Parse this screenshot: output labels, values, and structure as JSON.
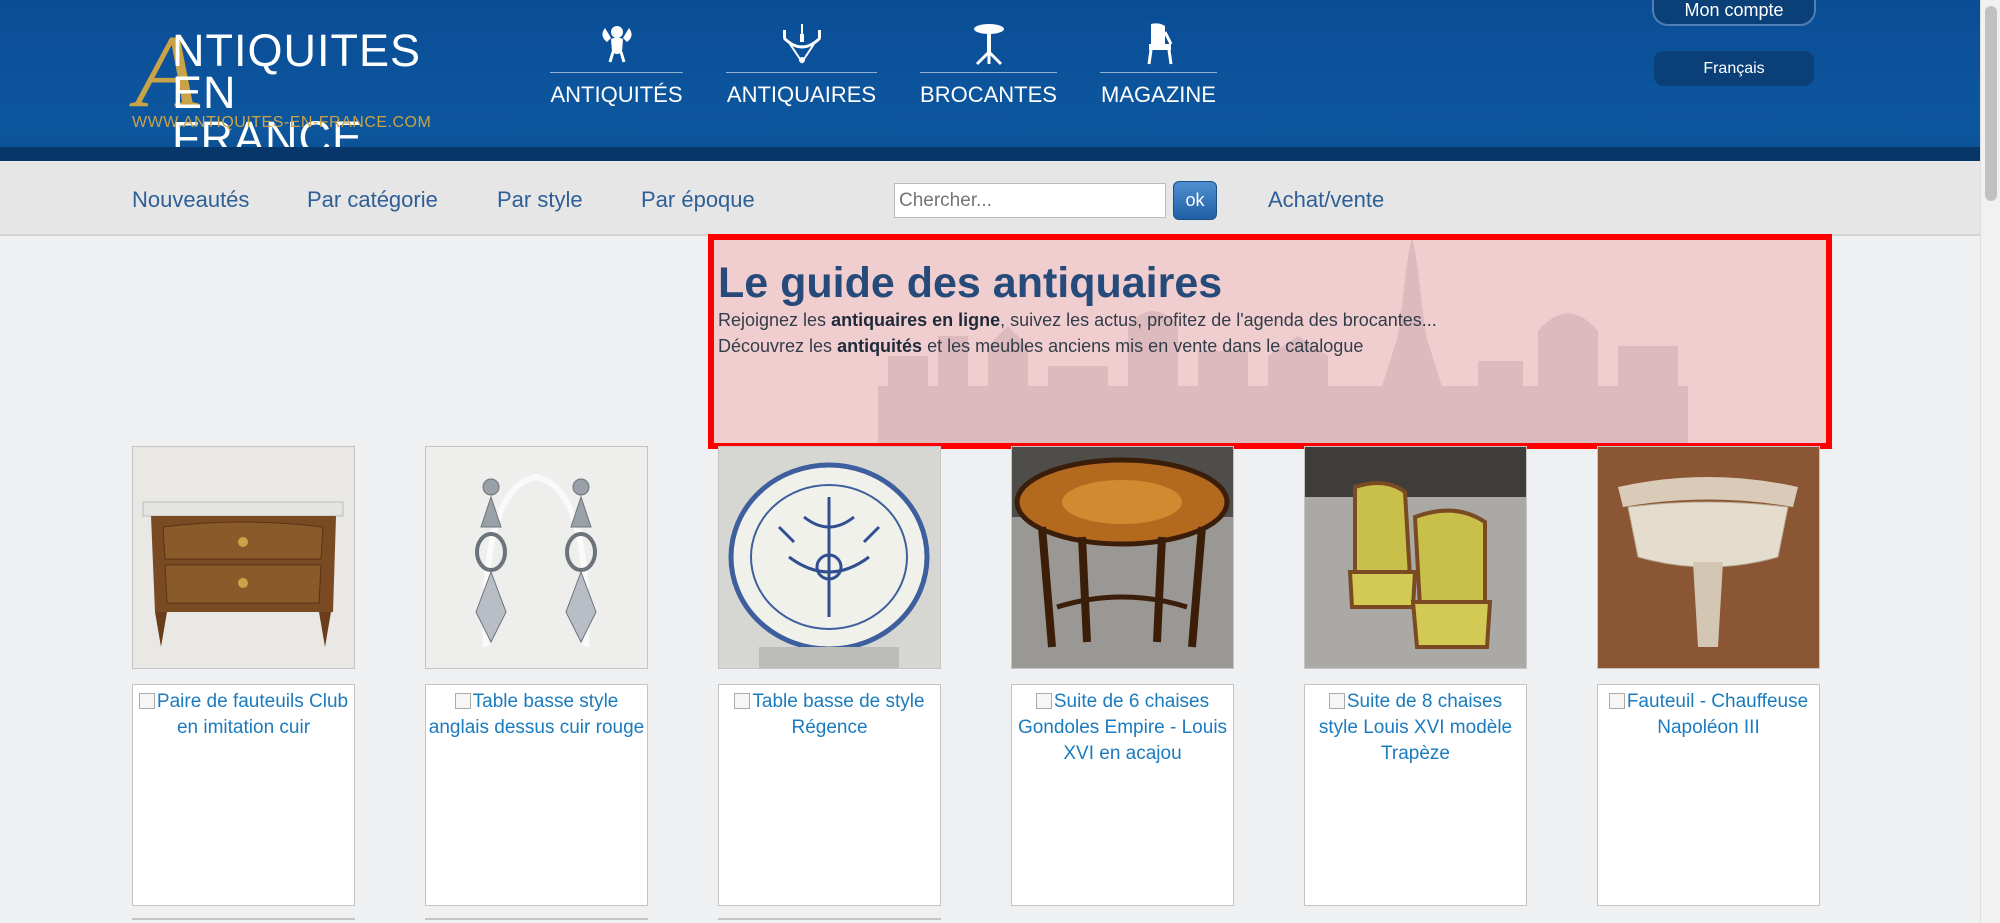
{
  "header": {
    "logo_line1": "NTIQUITES",
    "logo_line2": "EN FRANCE",
    "logo_letter": "A",
    "logo_url": "WWW.ANTIQUITES-EN-FRANCE.COM",
    "nav": [
      {
        "label": "ANTIQUITÉS",
        "icon": "cherub-icon"
      },
      {
        "label": "ANTIQUAIRES",
        "icon": "chandelier-icon"
      },
      {
        "label": "BROCANTES",
        "icon": "pedestal-table-icon"
      },
      {
        "label": "MAGAZINE",
        "icon": "chair-icon"
      }
    ],
    "account_label": "Mon compte",
    "language_label": "Français"
  },
  "subnav": {
    "links": [
      "Nouveautés",
      "Par catégorie",
      "Par style",
      "Par époque"
    ],
    "search_placeholder": "Chercher...",
    "search_button": "ok",
    "buy_sell": "Achat/vente"
  },
  "hero": {
    "title": "Le guide des antiquaires",
    "line1_pre": "Rejoignez les ",
    "line1_bold": "antiquaires en ligne",
    "line1_post": ", suivez les actus, profitez de l'agenda des brocantes...",
    "line2_pre": "Découvrez les ",
    "line2_bold": "antiquités",
    "line2_post": " et les meubles anciens mis en vente dans le catalogue"
  },
  "products_row1": [
    {
      "image": "commode-photo"
    },
    {
      "image": "earrings-photo"
    },
    {
      "image": "faience-plate-photo"
    },
    {
      "image": "marquetry-table-photo"
    },
    {
      "image": "armchairs-photo"
    },
    {
      "image": "console-photo"
    }
  ],
  "products_row2": [
    {
      "caption": "Paire de fauteuils Club en imitation cuir"
    },
    {
      "caption": "Table basse style anglais dessus cuir rouge"
    },
    {
      "caption": "Table basse de style Régence"
    },
    {
      "caption": "Suite de 6 chaises Gondoles Empire - Louis XVI en acajou"
    },
    {
      "caption": "Suite de 8 chaises style Louis XVI modèle Trapèze"
    },
    {
      "caption": "Fauteuil - Chauffeuse Napoléon III"
    }
  ],
  "colors": {
    "header_blue": "#0d579f",
    "gold": "#c9a347",
    "link_blue": "#2e5f96",
    "highlight_red": "#ff0000"
  }
}
